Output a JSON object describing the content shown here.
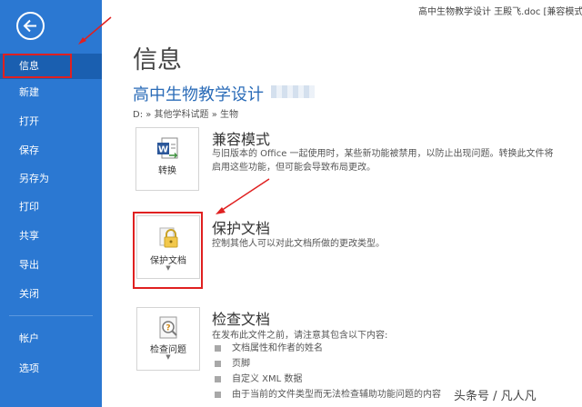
{
  "window": {
    "title": "高中生物教学设计 王殿飞.doc [兼容模式"
  },
  "sidebar": {
    "items": [
      {
        "label": "信息"
      },
      {
        "label": "新建"
      },
      {
        "label": "打开"
      },
      {
        "label": "保存"
      },
      {
        "label": "另存为"
      },
      {
        "label": "打印"
      },
      {
        "label": "共享"
      },
      {
        "label": "导出"
      },
      {
        "label": "关闭"
      },
      {
        "label": "帐户"
      },
      {
        "label": "选项"
      }
    ]
  },
  "main": {
    "page_title": "信息",
    "doc_title": "高中生物教学设计",
    "breadcrumb": "D: » 其他学科试题 » 生物",
    "compat": {
      "tile_label": "转换",
      "heading": "兼容模式",
      "desc_line1": "与旧版本的 Office 一起使用时，某些新功能被禁用，以防止出现问题。转换此文件将",
      "desc_line2": "启用这些功能，但可能会导致布局更改。"
    },
    "protect": {
      "tile_label": "保护文档",
      "heading": "保护文档",
      "desc": "控制其他人可以对此文档所做的更改类型。"
    },
    "inspect": {
      "tile_label": "检查问题",
      "heading": "检查文档",
      "desc": "在发布此文件之前，请注意其包含以下内容:",
      "bullets": [
        "文档属性和作者的姓名",
        "页脚",
        "自定义 XML 数据",
        "由于当前的文件类型而无法检查辅助功能问题的内容"
      ]
    }
  },
  "watermark": "头条号 / 凡人凡",
  "colors": {
    "sidebar": "#2b78d2",
    "sidebar_active": "#1a5fb0",
    "accent": "#2b6cb8",
    "annotation": "#e02020"
  }
}
